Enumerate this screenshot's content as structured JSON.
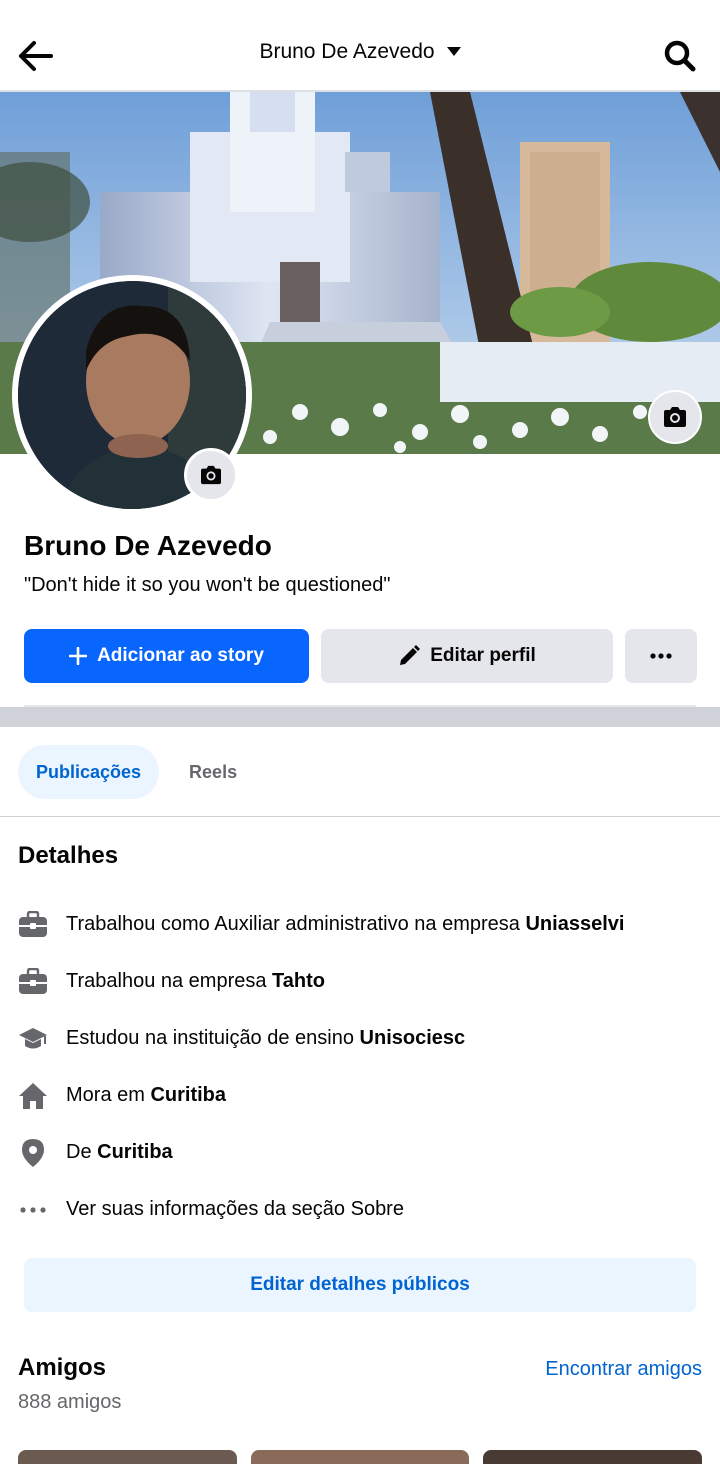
{
  "header": {
    "title": "Bruno De Azevedo",
    "back_icon": "arrow-left-icon",
    "dropdown_icon": "caret-down-icon",
    "search_icon": "search-icon"
  },
  "profile": {
    "name": "Bruno De Azevedo",
    "bio": "\"Don't hide it so you won't be questioned\""
  },
  "actions": {
    "add_story": "Adicionar ao story",
    "edit_profile": "Editar perfil",
    "more_icon": "more-horizontal-icon"
  },
  "tabs": [
    {
      "label": "Publicações",
      "active": true
    },
    {
      "label": "Reels",
      "active": false
    }
  ],
  "details": {
    "title": "Detalhes",
    "items": [
      {
        "icon": "briefcase-icon",
        "text": "Trabalhou como Auxiliar administrativo na empresa ",
        "bold": "Uniasselvi"
      },
      {
        "icon": "briefcase-icon",
        "text": "Trabalhou na empresa ",
        "bold": "Tahto"
      },
      {
        "icon": "graduation-cap-icon",
        "text": "Estudou na instituição de ensino ",
        "bold": "Unisociesc"
      },
      {
        "icon": "home-icon",
        "text": "Mora em ",
        "bold": "Curitiba"
      },
      {
        "icon": "location-pin-icon",
        "text": "De ",
        "bold": "Curitiba"
      },
      {
        "icon": "more-horizontal-icon",
        "text": "Ver suas informações da seção Sobre",
        "bold": ""
      }
    ],
    "edit_button": "Editar detalhes públicos"
  },
  "friends": {
    "title": "Amigos",
    "find_link": "Encontrar amigos",
    "count": "888 amigos"
  },
  "colors": {
    "primary": "#0866ff",
    "link": "#0064d1",
    "secondary_bg": "#e4e6eb",
    "tab_active_bg": "#ebf5ff"
  }
}
